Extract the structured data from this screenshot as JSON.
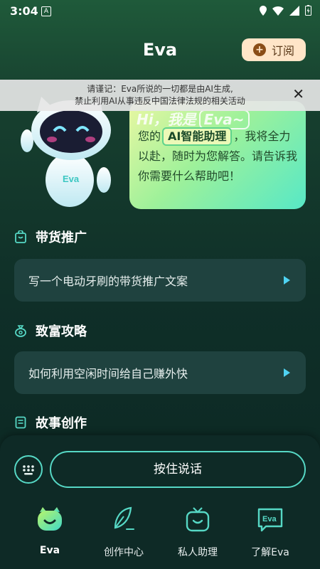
{
  "status_bar": {
    "time": "3:04",
    "sim_icon": "A"
  },
  "header": {
    "title": "Eva",
    "subscribe_label": "订阅"
  },
  "notice": {
    "line1": "请谨记：Eva所说的一切都是由AI生成,",
    "line2": "禁止利用AI从事违反中国法律法规的相关活动"
  },
  "greeting": {
    "hi": "Hi，我是",
    "name": "Eva~",
    "text_before": "您的",
    "tag": "AI智能助理",
    "text_after": "，我将全力以赴，随时为您解答。请告诉我你需要什么帮助吧！"
  },
  "robot": {
    "badge": "Eva"
  },
  "sections": [
    {
      "title": "带货推广",
      "card": "写一个电动牙刷的带货推广文案"
    },
    {
      "title": "致富攻略",
      "card": "如何利用空闲时间给自己赚外快"
    },
    {
      "title": "故事创作"
    }
  ],
  "input": {
    "talk_label": "按住说话"
  },
  "nav": [
    {
      "label": "Eva"
    },
    {
      "label": "创作中心"
    },
    {
      "label": "私人助理"
    },
    {
      "label": "了解Eva",
      "badge": "Eva"
    }
  ],
  "colors": {
    "accent": "#56d8c5",
    "arrow": "#4fd3f2",
    "card": "#1f423f"
  }
}
